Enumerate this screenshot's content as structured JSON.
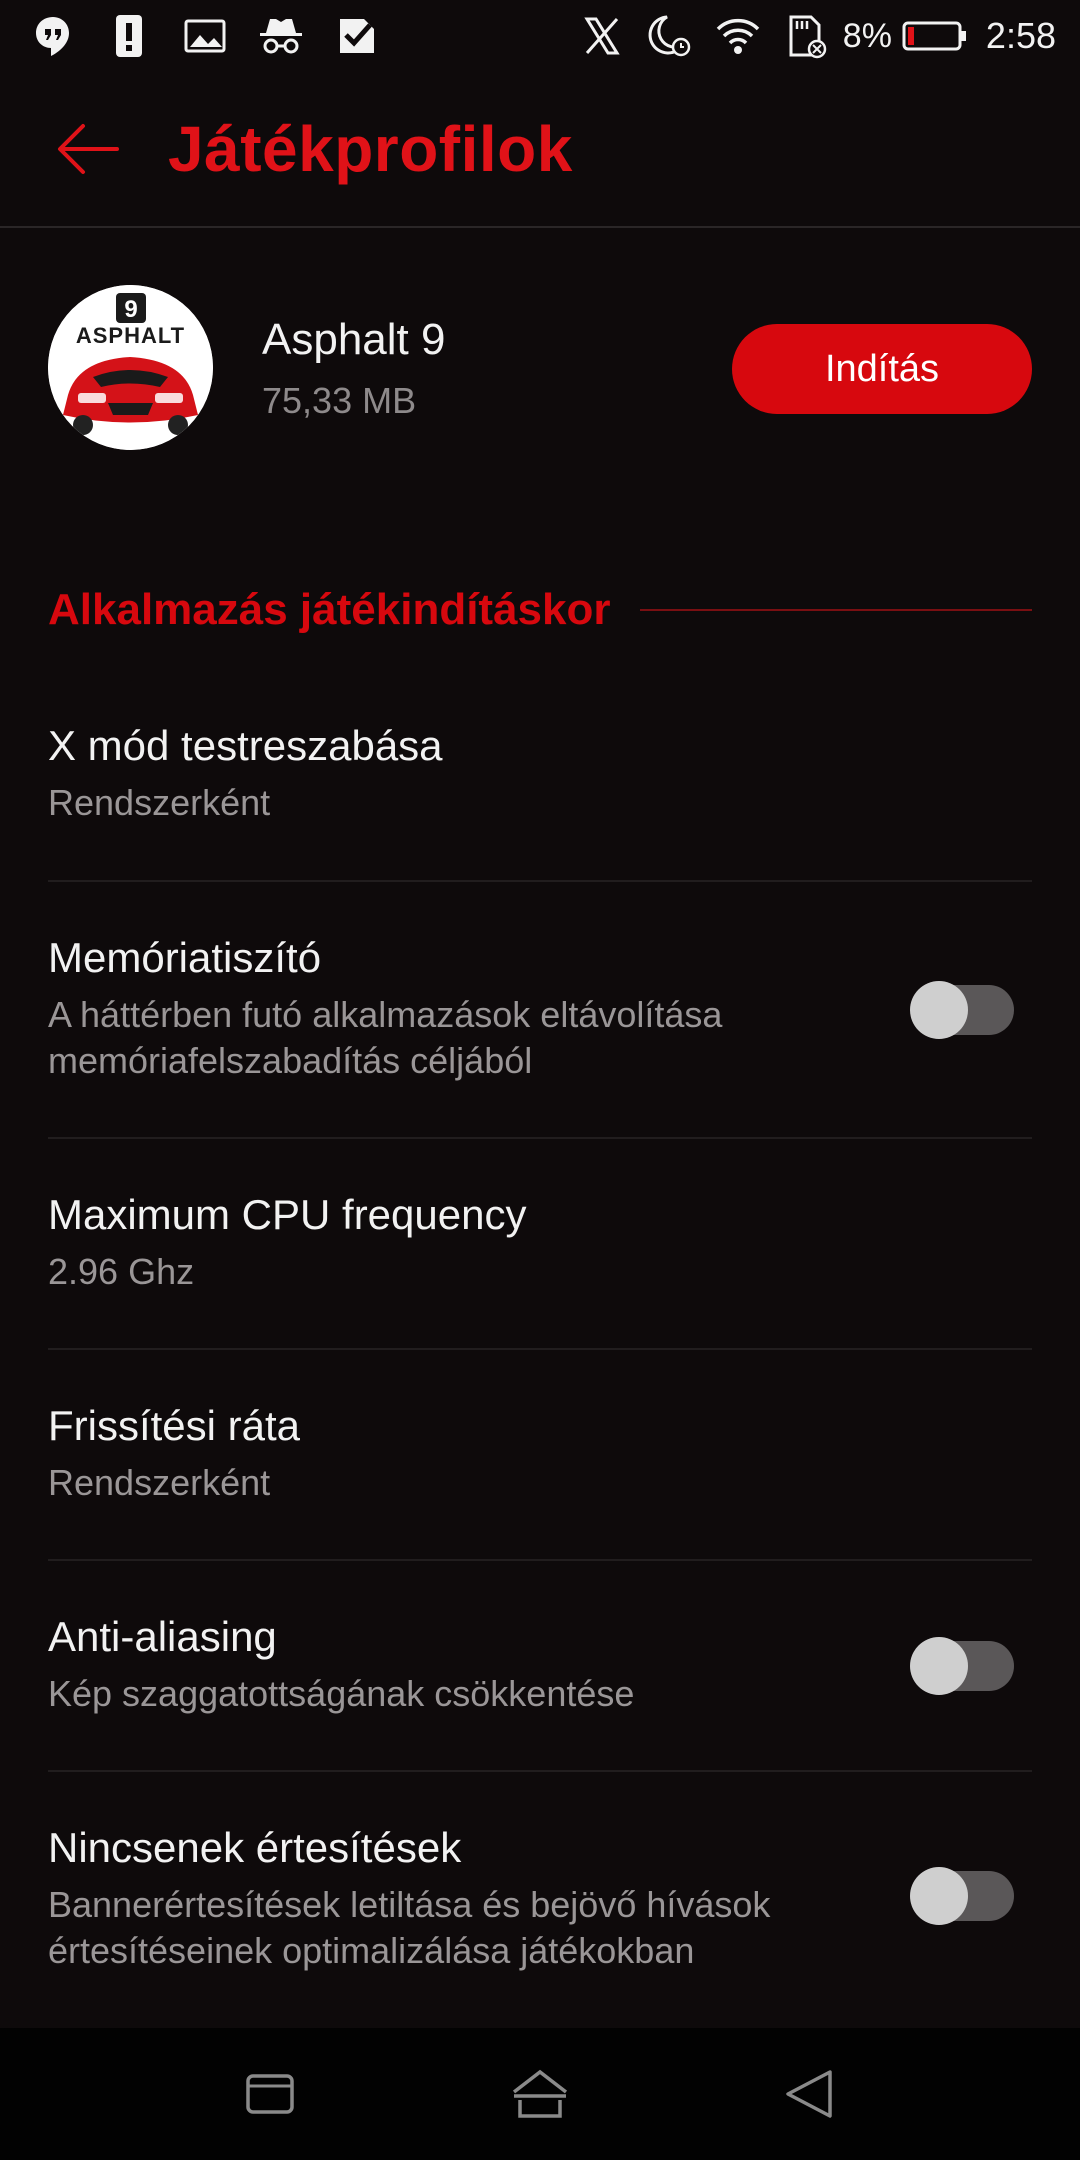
{
  "status_bar": {
    "left_icons": [
      "hangouts-icon",
      "alert-icon",
      "image-icon",
      "incognito-icon",
      "checkmark-app-icon"
    ],
    "right_icons": [
      "x-icon",
      "do-not-disturb-alarm-icon",
      "wifi-icon",
      "sd-card-icon"
    ],
    "battery_pct": "8%",
    "time": "2:58"
  },
  "app_bar": {
    "title": "Játékprofilok"
  },
  "game": {
    "icon_text": "ASPHALT",
    "icon_badge": "9",
    "name": "Asphalt 9",
    "size": "75,33 MB",
    "launch_label": "Indítás"
  },
  "section": {
    "title": "Alkalmazás játékindításkor"
  },
  "settings": [
    {
      "title": "X mód testreszabása",
      "subtitle": "Rendszerként",
      "toggle": null
    },
    {
      "title": "Memóriatiszító",
      "subtitle_line1": "A háttérben futó alkalmazások eltávolítása",
      "subtitle_line2": "memóriafelszabadítás céljából",
      "toggle": false
    },
    {
      "title": "Maximum CPU frequency",
      "subtitle": "2.96 Ghz",
      "toggle": null
    },
    {
      "title": "Frissítési ráta",
      "subtitle": "Rendszerként",
      "toggle": null
    },
    {
      "title": "Anti-aliasing",
      "subtitle": "Kép szaggatottságának csökkentése",
      "toggle": false
    },
    {
      "title": "Nincsenek értesítések",
      "subtitle_line1": "Bannerértesítések letiltása és bejövő hívások",
      "subtitle_line2": "értesítéseinek optimalizálása játékokban",
      "toggle": false
    }
  ],
  "colors": {
    "accent": "#d7080e",
    "background": "#0e0a0b",
    "toggle_off_track": "#5a5758",
    "toggle_off_thumb": "#cfcfcf"
  },
  "nav_bar": {
    "buttons": [
      "recents-icon",
      "home-icon",
      "back-nav-icon"
    ]
  }
}
